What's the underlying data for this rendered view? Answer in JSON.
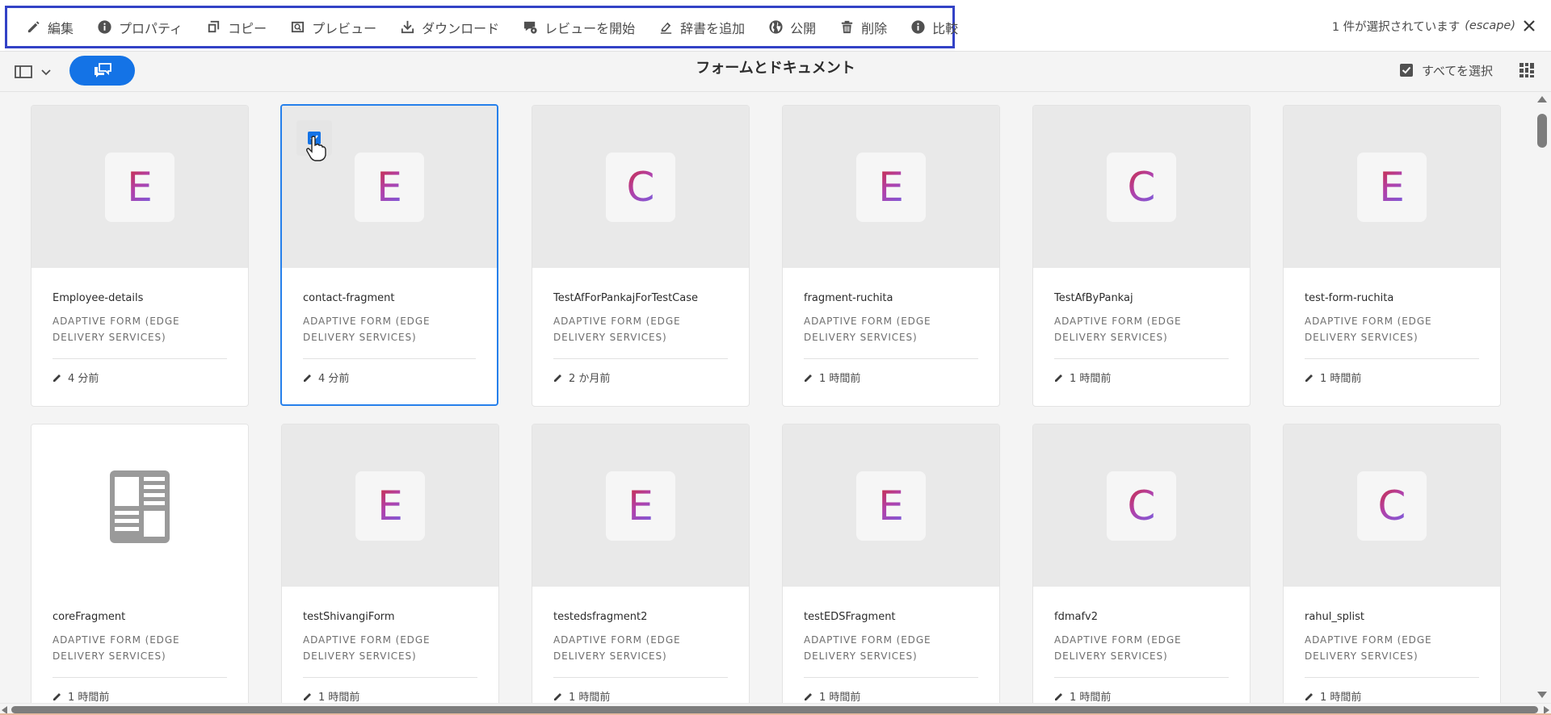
{
  "actions": [
    {
      "name": "edit",
      "label": "編集",
      "icon": "pencil-icon"
    },
    {
      "name": "properties",
      "label": "プロパティ",
      "icon": "info-icon"
    },
    {
      "name": "copy",
      "label": "コピー",
      "icon": "copy-icon"
    },
    {
      "name": "preview",
      "label": "プレビュー",
      "icon": "preview-icon"
    },
    {
      "name": "download",
      "label": "ダウンロード",
      "icon": "download-icon"
    },
    {
      "name": "start-review",
      "label": "レビューを開始",
      "icon": "review-icon"
    },
    {
      "name": "add-dictionary",
      "label": "辞書を追加",
      "icon": "dictionary-icon"
    },
    {
      "name": "publish",
      "label": "公開",
      "icon": "globe-icon"
    },
    {
      "name": "delete",
      "label": "削除",
      "icon": "trash-icon"
    },
    {
      "name": "compare",
      "label": "比較",
      "icon": "info-icon"
    }
  ],
  "selection": {
    "text": "1 件が選択されています",
    "hint": "(escape)"
  },
  "header": {
    "title": "フォームとドキュメント",
    "select_all": "すべてを選択"
  },
  "colors": {
    "accent": "#1473e6",
    "highlight": "#3342c6",
    "selected_border": "#2680eb"
  },
  "cards": [
    {
      "title": "Employee-details",
      "type": "ADAPTIVE FORM (EDGE DELIVERY SERVICES)",
      "letter": "E",
      "time": "4 分前",
      "selected": false
    },
    {
      "title": "contact-fragment",
      "type": "ADAPTIVE FORM (EDGE DELIVERY SERVICES)",
      "letter": "E",
      "time": "4 分前",
      "selected": true
    },
    {
      "title": "TestAfForPankajForTestCase",
      "type": "ADAPTIVE FORM (EDGE DELIVERY SERVICES)",
      "letter": "C",
      "time": "2 か月前",
      "selected": false
    },
    {
      "title": "fragment-ruchita",
      "type": "ADAPTIVE FORM (EDGE DELIVERY SERVICES)",
      "letter": "E",
      "time": "1 時間前",
      "selected": false
    },
    {
      "title": "TestAfByPankaj",
      "type": "ADAPTIVE FORM (EDGE DELIVERY SERVICES)",
      "letter": "C",
      "time": "1 時間前",
      "selected": false
    },
    {
      "title": "test-form-ruchita",
      "type": "ADAPTIVE FORM (EDGE DELIVERY SERVICES)",
      "letter": "E",
      "time": "1 時間前",
      "selected": false
    },
    {
      "title": "coreFragment",
      "type": "ADAPTIVE FORM (EDGE DELIVERY SERVICES)",
      "letter": "",
      "icon": "document-icon",
      "time": "1 時間前",
      "selected": false
    },
    {
      "title": "testShivangiForm",
      "type": "ADAPTIVE FORM (EDGE DELIVERY SERVICES)",
      "letter": "E",
      "time": "1 時間前",
      "selected": false
    },
    {
      "title": "testedsfragment2",
      "type": "ADAPTIVE FORM (EDGE DELIVERY SERVICES)",
      "letter": "E",
      "time": "1 時間前",
      "selected": false
    },
    {
      "title": "testEDSFragment",
      "type": "ADAPTIVE FORM (EDGE DELIVERY SERVICES)",
      "letter": "E",
      "time": "1 時間前",
      "selected": false
    },
    {
      "title": "fdmafv2",
      "type": "ADAPTIVE FORM (EDGE DELIVERY SERVICES)",
      "letter": "C",
      "time": "1 時間前",
      "selected": false
    },
    {
      "title": "rahul_splist",
      "type": "ADAPTIVE FORM (EDGE DELIVERY SERVICES)",
      "letter": "C",
      "time": "1 時間前",
      "selected": false
    }
  ]
}
